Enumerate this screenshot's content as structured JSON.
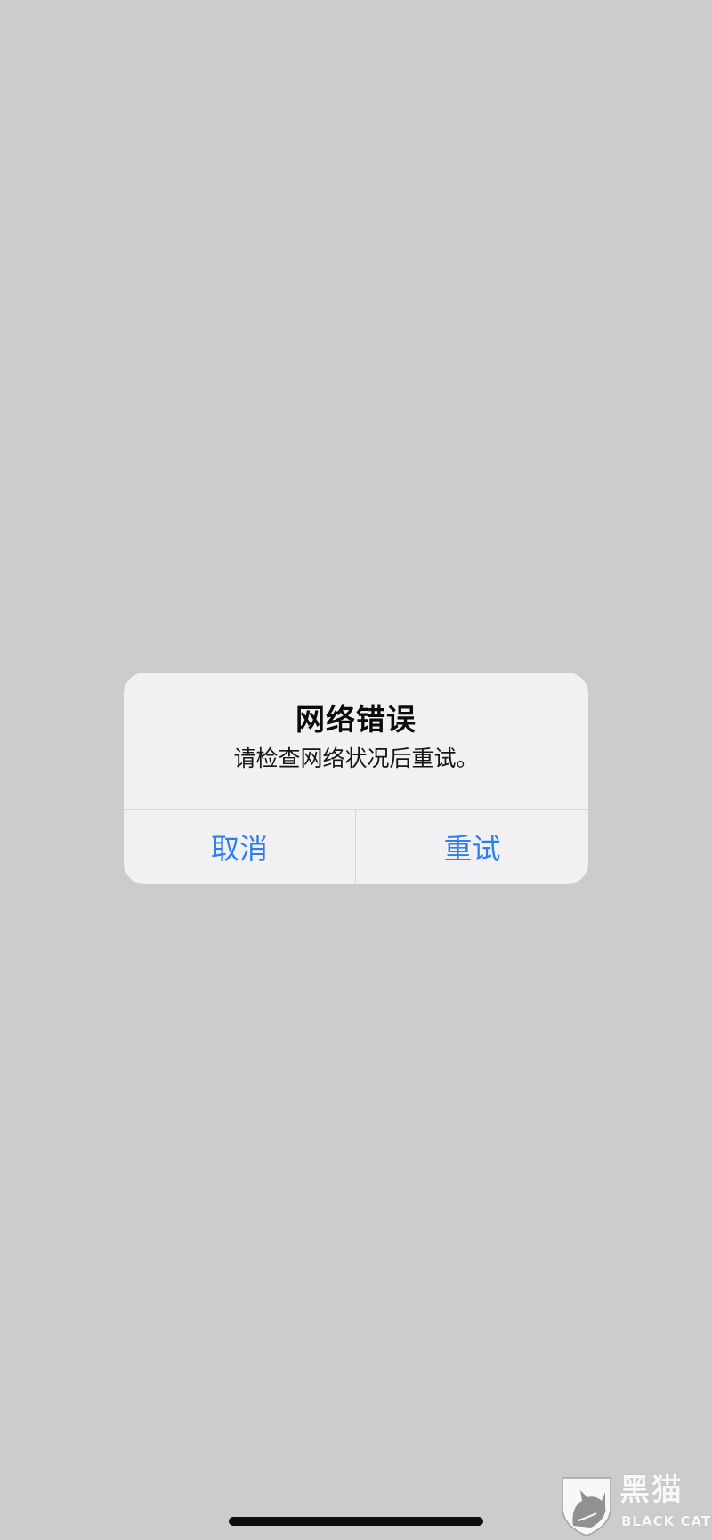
{
  "alert": {
    "title": "网络错误",
    "message": "请检查网络状况后重试。",
    "cancel_label": "取消",
    "retry_label": "重试"
  },
  "watermark": {
    "brand_cn": "黑猫",
    "brand_en": "BLACK CAT",
    "icon": "black-cat-shield-icon"
  },
  "colors": {
    "background": "#cccccc",
    "alert_background": "#f1f1f3",
    "button_text": "#2f7ef0",
    "divider": "#d6d6da",
    "home_indicator": "#0d0d0d"
  }
}
